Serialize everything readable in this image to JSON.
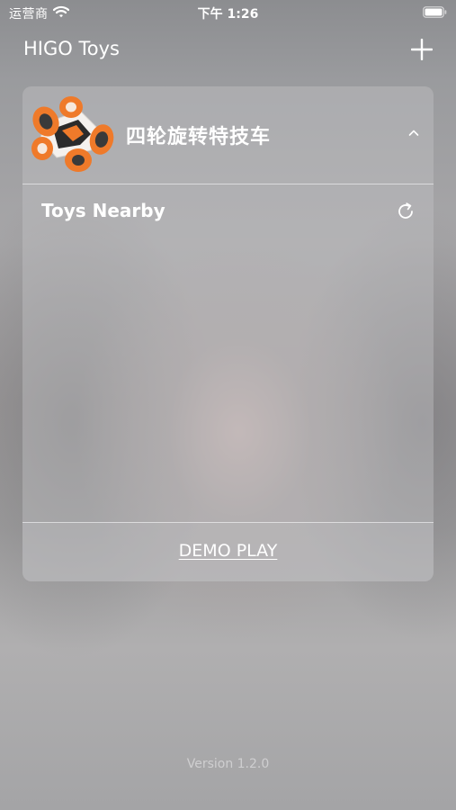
{
  "status_bar": {
    "carrier": "运营商",
    "time": "下午 1:26",
    "wifi_icon": "wifi-icon",
    "battery_icon": "battery-icon"
  },
  "nav": {
    "title": "HIGO Toys",
    "add_icon": "plus-icon"
  },
  "device_card": {
    "toy_name": "四轮旋转特技车",
    "toy_image": "stunt-car-image",
    "expanded": true,
    "collapse_icon": "chevron-up-icon",
    "nearby": {
      "title": "Toys Nearby",
      "refresh_icon": "refresh-icon",
      "items": []
    },
    "demo_play_label": "DEMO PLAY"
  },
  "footer": {
    "version": "Version 1.2.0"
  },
  "colors": {
    "toy_accent": "#ef7a2a",
    "text": "#ffffff"
  }
}
